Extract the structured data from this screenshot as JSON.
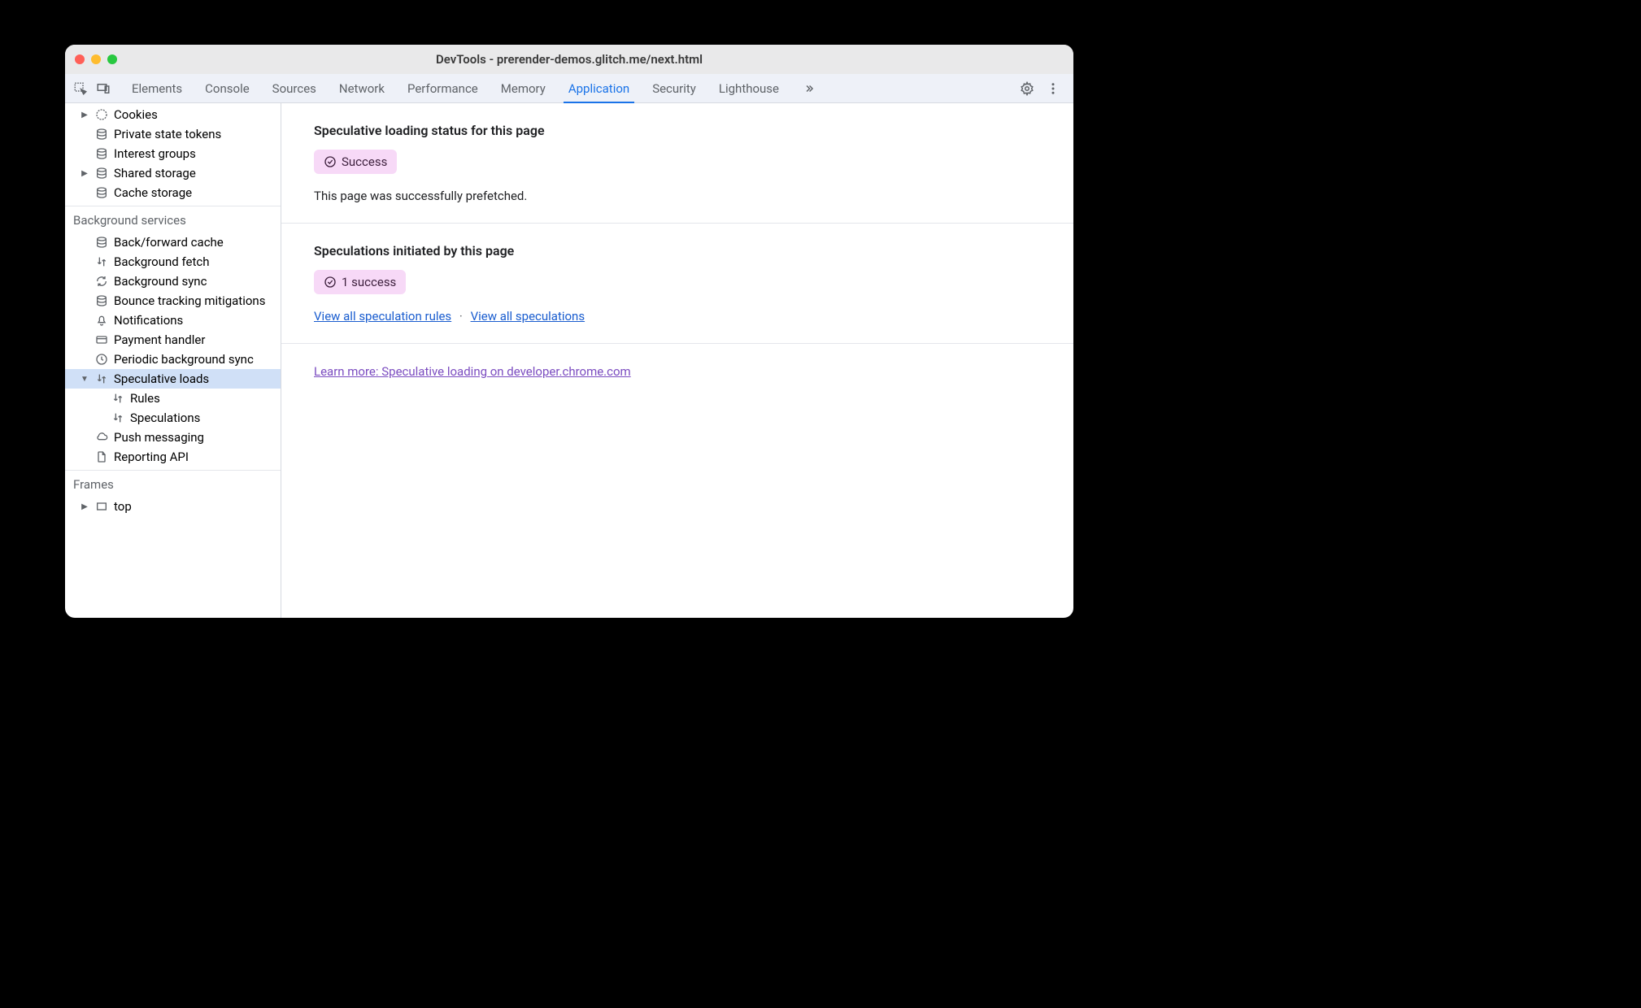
{
  "window": {
    "title": "DevTools - prerender-demos.glitch.me/next.html"
  },
  "tabs": [
    {
      "label": "Elements"
    },
    {
      "label": "Console"
    },
    {
      "label": "Sources"
    },
    {
      "label": "Network"
    },
    {
      "label": "Performance"
    },
    {
      "label": "Memory"
    },
    {
      "label": "Application"
    },
    {
      "label": "Security"
    },
    {
      "label": "Lighthouse"
    }
  ],
  "sidebar": {
    "storage": {
      "cookies": "Cookies",
      "private_state_tokens": "Private state tokens",
      "interest_groups": "Interest groups",
      "shared_storage": "Shared storage",
      "cache_storage": "Cache storage"
    },
    "background_services": {
      "header": "Background services",
      "back_forward_cache": "Back/forward cache",
      "background_fetch": "Background fetch",
      "background_sync": "Background sync",
      "bounce_tracking": "Bounce tracking mitigations",
      "notifications": "Notifications",
      "payment_handler": "Payment handler",
      "periodic_bg_sync": "Periodic background sync",
      "speculative_loads": "Speculative loads",
      "rules": "Rules",
      "speculations": "Speculations",
      "push_messaging": "Push messaging",
      "reporting_api": "Reporting API"
    },
    "frames": {
      "header": "Frames",
      "top": "top"
    }
  },
  "main": {
    "status_heading": "Speculative loading status for this page",
    "status_badge": "Success",
    "status_desc": "This page was successfully prefetched.",
    "initiated_heading": "Speculations initiated by this page",
    "initiated_badge": "1 success",
    "link_rules": "View all speculation rules",
    "link_specs": "View all speculations",
    "learn_more": "Learn more: Speculative loading on developer.chrome.com"
  }
}
